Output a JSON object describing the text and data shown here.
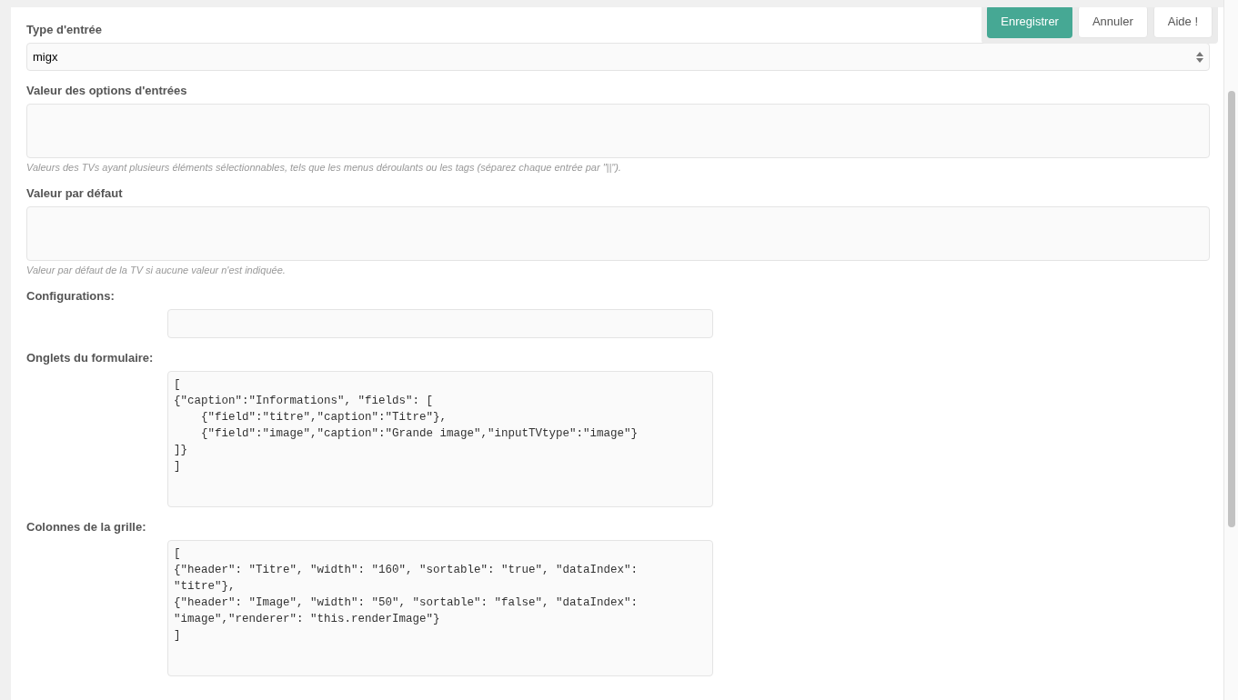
{
  "toolbar": [
    {
      "label": "Enregistrer",
      "kind": "primary"
    },
    {
      "label": "Annuler",
      "kind": "default"
    },
    {
      "label": "Aide !",
      "kind": "default"
    }
  ],
  "fields": [
    {
      "kind": "select",
      "label": "Type d'entrée",
      "value": "migx"
    },
    {
      "kind": "textarea",
      "label": "Valeur des options d'entrées",
      "help": "Valeurs des TVs ayant plusieurs éléments sélectionnables, tels que les menus déroulants ou les tags (séparez chaque entrée par \"||\")."
    },
    {
      "kind": "textarea",
      "label": "Valeur par défaut",
      "help": "Valeur par défaut de la TV si aucune valeur n'est indiquée."
    },
    {
      "kind": "text",
      "label": "Configurations:"
    },
    {
      "kind": "code",
      "label": "Onglets du formulaire:",
      "value": "[\n{\"caption\":\"Informations\", \"fields\": [\n    {\"field\":\"titre\",\"caption\":\"Titre\"},\n    {\"field\":\"image\",\"caption\":\"Grande image\",\"inputTVtype\":\"image\"}\n]}\n]"
    },
    {
      "kind": "code",
      "label": "Colonnes de la grille:",
      "value": "[\n{\"header\": \"Titre\", \"width\": \"160\", \"sortable\": \"true\", \"dataIndex\":\n\"titre\"},\n{\"header\": \"Image\", \"width\": \"50\", \"sortable\": \"false\", \"dataIndex\":\n\"image\",\"renderer\": \"this.renderImage\"}\n]"
    }
  ]
}
